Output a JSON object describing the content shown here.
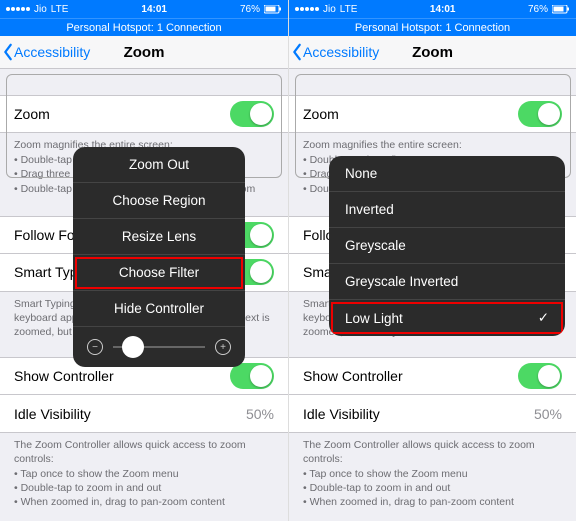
{
  "status": {
    "carrier": "Jio",
    "network": "LTE",
    "time": "14:01",
    "battery": "76%"
  },
  "hotspot": "Personal Hotspot: 1 Connection",
  "nav": {
    "back": "Accessibility",
    "title": "Zoom"
  },
  "cells": {
    "zoom": "Zoom",
    "follow": "Follow Focus",
    "smart": "Smart Typing",
    "show_controller": "Show Controller",
    "idle_visibility": "Idle Visibility",
    "idle_value": "50%"
  },
  "desc1": {
    "hd": "Zoom magnifies the entire screen:",
    "b1": "• Double-tap three fingers to zoom",
    "b2": "• Drag three fingers to move around the screen",
    "b3": "• Double-tap three fingers and drag to change zoom"
  },
  "desc2": {
    "hd": "Smart Typing will switch to Window Zoom when a keyboard appears and move the Window so that text is zoomed, but the keyboard is not.",
    "short_l": "Smart Typing switches to Window Zoom when a",
    "short_l2": "keyboard appears and move the Window so that text is",
    "short_l3": "zoomed, but the keyboard is not.",
    "short_r": "Smart Typing switches to Window Zoom when a",
    "short_r2": "keyboard appears and move the Window so that text is",
    "short_r3": "zoomed, but the keyboard is not."
  },
  "desc3": {
    "hd": "The Zoom Controller allows quick access to zoom controls:",
    "b1": "• Tap once to show the Zoom menu",
    "b2": "• Double-tap to zoom in and out",
    "b3": "• When zoomed in, drag to pan-zoom content"
  },
  "menu_left": {
    "items": [
      "Zoom Out",
      "Choose Region",
      "Resize Lens",
      "Choose Filter",
      "Hide Controller"
    ]
  },
  "menu_right": {
    "items": [
      "None",
      "Inverted",
      "Greyscale",
      "Greyscale Inverted",
      "Low Light"
    ]
  }
}
